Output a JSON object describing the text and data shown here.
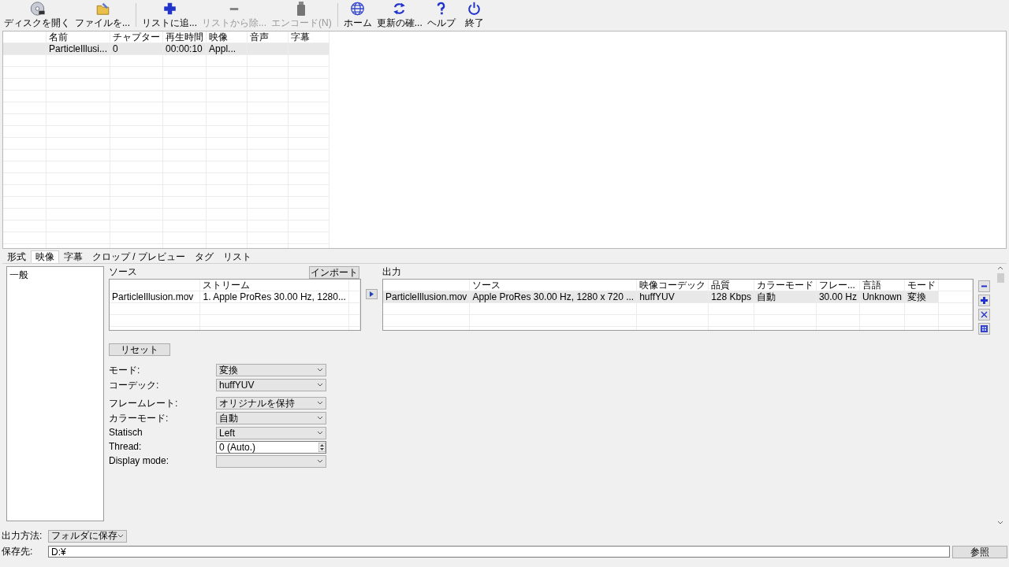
{
  "toolbar_groups": [
    [
      {
        "label": "ディスクを開く",
        "disabled": false
      },
      {
        "label": "ファイルを...",
        "disabled": false
      }
    ],
    [
      {
        "label": "リストに追...",
        "disabled": false
      },
      {
        "label": "リストから除...",
        "disabled": true
      },
      {
        "label": "エンコード(N)",
        "disabled": true
      }
    ],
    [
      {
        "label": "ホーム",
        "disabled": false
      },
      {
        "label": "更新の確...",
        "disabled": false
      },
      {
        "label": "ヘルプ",
        "disabled": false
      },
      {
        "label": "終了",
        "disabled": false
      }
    ]
  ],
  "file_list": {
    "columns": [
      "名前",
      "チャプター",
      "再生時間",
      "映像",
      "音声",
      "字幕"
    ],
    "rows": [
      {
        "cells": [
          "ParticleIllusi...",
          "0",
          "00:00:10",
          "Appl..."
        ],
        "selected": true
      }
    ]
  },
  "tabs": [
    {
      "label": "形式",
      "selected": false
    },
    {
      "label": "映像",
      "selected": true
    },
    {
      "label": "字幕",
      "selected": false
    },
    {
      "label": "クロップ / プレビュー",
      "selected": false
    },
    {
      "label": "タグ",
      "selected": false
    },
    {
      "label": "リスト",
      "selected": false
    }
  ],
  "tree": {
    "items": [
      {
        "label": "一般"
      }
    ]
  },
  "source": {
    "label": "ソース",
    "import_button": "インポート",
    "stream_heading": "ストリーム",
    "rows": [
      {
        "file": "ParticleIllusion.mov",
        "stream": "1. Apple ProRes 30.00 Hz, 1280..."
      }
    ]
  },
  "output": {
    "label": "出力",
    "columns": [
      "",
      "ソース",
      "映像コーデック",
      "品質",
      "カラーモード",
      "フレー...",
      "言語",
      "モード"
    ],
    "rows": [
      {
        "cells": [
          "ParticleIllusion.mov",
          "Apple ProRes 30.00 Hz, 1280 x 720 ...",
          "huffYUV",
          "128 Kbps",
          "自動",
          "30.00 Hz",
          "Unknown",
          "変換"
        ],
        "selected": true
      }
    ]
  },
  "reset_button": "リセット",
  "settings_groups": [
    [
      {
        "label": "モード:",
        "kind": "dropdown",
        "value": "変換"
      },
      {
        "label": "コーデック:",
        "kind": "dropdown",
        "value": "huffYUV"
      }
    ],
    [
      {
        "label": "フレームレート:",
        "kind": "dropdown",
        "value": "オリジナルを保持"
      },
      {
        "label": "カラーモード:",
        "kind": "dropdown",
        "value": "自動"
      },
      {
        "label": "Statisch",
        "kind": "dropdown",
        "value": "Left"
      },
      {
        "label": "Thread:",
        "kind": "spinner",
        "value": "0 (Auto.)"
      },
      {
        "label": "Display mode:",
        "kind": "dropdown"
      }
    ]
  ],
  "output_method": {
    "label": "出力方法:",
    "value": "フォルダに保存"
  },
  "destination": {
    "label": "保存先:",
    "value": "D:¥",
    "browse_button": "参照"
  }
}
